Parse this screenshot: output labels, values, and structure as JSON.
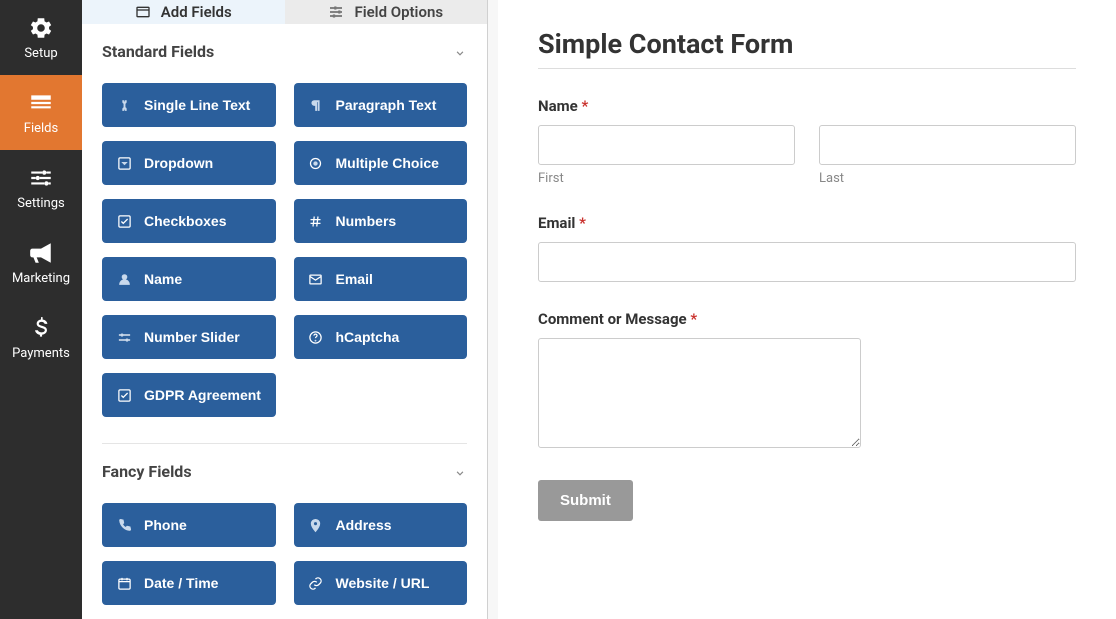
{
  "nav": [
    {
      "label": "Setup",
      "icon": "gear"
    },
    {
      "label": "Fields",
      "icon": "form",
      "active": true
    },
    {
      "label": "Settings",
      "icon": "sliders"
    },
    {
      "label": "Marketing",
      "icon": "bullhorn"
    },
    {
      "label": "Payments",
      "icon": "dollar"
    }
  ],
  "tabs": {
    "add": "Add Fields",
    "options": "Field Options"
  },
  "sections": {
    "standard": {
      "title": "Standard Fields",
      "fields": [
        {
          "label": "Single Line Text",
          "icon": "text-cursor"
        },
        {
          "label": "Paragraph Text",
          "icon": "paragraph"
        },
        {
          "label": "Dropdown",
          "icon": "caret-square"
        },
        {
          "label": "Multiple Choice",
          "icon": "radio"
        },
        {
          "label": "Checkboxes",
          "icon": "check-square"
        },
        {
          "label": "Numbers",
          "icon": "hash"
        },
        {
          "label": "Name",
          "icon": "user"
        },
        {
          "label": "Email",
          "icon": "envelope"
        },
        {
          "label": "Number Slider",
          "icon": "sliders-h"
        },
        {
          "label": "hCaptcha",
          "icon": "question-circle"
        },
        {
          "label": "GDPR Agreement",
          "icon": "check-square"
        }
      ]
    },
    "fancy": {
      "title": "Fancy Fields",
      "fields": [
        {
          "label": "Phone",
          "icon": "phone"
        },
        {
          "label": "Address",
          "icon": "map-marker"
        },
        {
          "label": "Date / Time",
          "icon": "calendar"
        },
        {
          "label": "Website / URL",
          "icon": "link"
        }
      ]
    }
  },
  "form": {
    "title": "Simple Contact Form",
    "name_label": "Name",
    "first_sublabel": "First",
    "last_sublabel": "Last",
    "email_label": "Email",
    "comment_label": "Comment or Message",
    "submit": "Submit"
  }
}
